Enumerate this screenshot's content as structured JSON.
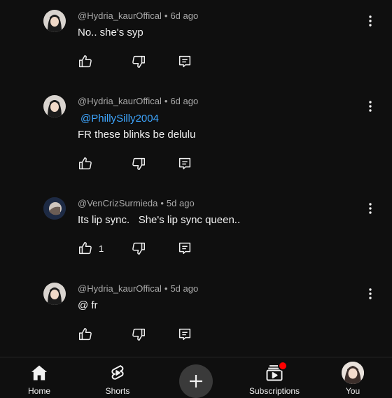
{
  "comments": [
    {
      "author": "@Hydria_kaurOffical",
      "time": "6d ago",
      "mention": "",
      "text": "No.. she's syp",
      "likes": ""
    },
    {
      "author": "@Hydria_kaurOffical",
      "time": "6d ago",
      "mention": "@PhillySilly2004",
      "text": "FR these blinks be delulu",
      "likes": ""
    },
    {
      "author": "@VenCrizSurmieda",
      "time": "5d ago",
      "mention": "",
      "text": "Its lip sync.   She's lip sync queen..",
      "likes": "1"
    },
    {
      "author": "@Hydria_kaurOffical",
      "time": "5d ago",
      "mention": "",
      "text": "@ fr",
      "likes": ""
    }
  ],
  "separator": "•",
  "nav": {
    "home": "Home",
    "shorts": "Shorts",
    "subscriptions": "Subscriptions",
    "you": "You"
  },
  "icons": {
    "like": "thumb-up-icon",
    "dislike": "thumb-down-icon",
    "reply": "reply-icon",
    "more": "more-vert-icon",
    "home": "home-icon",
    "shorts": "shorts-icon",
    "create": "plus-icon",
    "subscriptions": "subscriptions-icon"
  },
  "colors": {
    "background": "#0f0f0f",
    "mention": "#3ea6ff",
    "meta": "#aaaaaa",
    "notification": "#ff0000"
  }
}
